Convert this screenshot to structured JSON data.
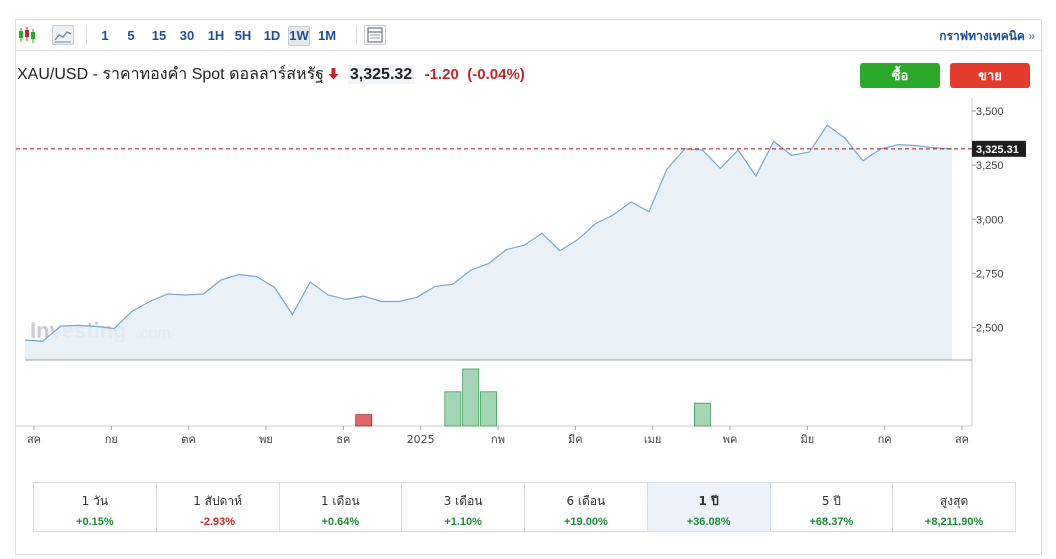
{
  "toolbar": {
    "intervals": [
      "1",
      "5",
      "15",
      "30",
      "1H",
      "5H",
      "1D",
      "1W",
      "1M"
    ],
    "active_interval": "1W",
    "tech_link": "กราฟทางเทคนิค",
    "tech_link_arrow": "»"
  },
  "header": {
    "pair": "XAU/USD - ราคาทองคำ Spot ดอลลาร์สหรัฐ",
    "direction": "down",
    "price": "3,325.32",
    "change": "-1.20",
    "change_pct": "(-0.04%)"
  },
  "actions": {
    "buy_label": "ซื้อ",
    "sell_label": "ขาย"
  },
  "watermark": {
    "brand": "Investing",
    "suffix": ".com"
  },
  "colors": {
    "line": "#7aa7cf",
    "area": "#e5eef6",
    "up_bar": "#a3d6b2",
    "down_bar": "#e06565",
    "ref_line": "#9b1c1c",
    "buy": "#2aa82a",
    "sell": "#e53b2c"
  },
  "chart_data": {
    "type": "area",
    "ylim": [
      2350,
      3560
    ],
    "y_ticks": [
      2500,
      2750,
      3000,
      3250,
      3500
    ],
    "y_tick_labels": [
      "2,500",
      "2,750",
      "3,000",
      "3,250",
      "3,500"
    ],
    "current_label": "3,325.31",
    "current_value": 3325.31,
    "grid": false,
    "x_labels": [
      "สค",
      "กย",
      "ตค",
      "พย",
      "ธค",
      "2025",
      "กพ",
      "มีค",
      "เมย",
      "พค",
      "มิย",
      "กค",
      "สค"
    ],
    "values": [
      2442,
      2437,
      2507,
      2510,
      2505,
      2495,
      2575,
      2620,
      2655,
      2650,
      2655,
      2720,
      2745,
      2735,
      2685,
      2560,
      2710,
      2650,
      2630,
      2645,
      2620,
      2620,
      2640,
      2690,
      2700,
      2765,
      2795,
      2860,
      2880,
      2935,
      2855,
      2905,
      2980,
      3020,
      3080,
      3035,
      3230,
      3325,
      3320,
      3235,
      3320,
      3200,
      3360,
      3295,
      3310,
      3435,
      3375,
      3270,
      3325,
      3345,
      3340,
      3330,
      3325
    ],
    "volume": [
      0,
      0,
      0,
      0,
      0,
      0,
      0,
      0,
      0,
      0,
      0,
      0,
      0,
      0,
      0,
      0,
      0,
      0,
      0,
      4,
      0,
      0,
      0,
      0,
      12,
      20,
      12,
      0,
      0,
      0,
      0,
      0,
      0,
      0,
      0,
      0,
      0,
      0,
      8,
      0,
      0,
      0,
      0,
      0,
      0,
      0,
      0,
      0,
      0,
      0,
      0,
      0,
      0
    ],
    "volume_direction": [
      "u",
      "u",
      "u",
      "u",
      "u",
      "u",
      "u",
      "u",
      "u",
      "u",
      "u",
      "u",
      "u",
      "u",
      "u",
      "u",
      "u",
      "u",
      "u",
      "d",
      "u",
      "u",
      "u",
      "u",
      "u",
      "u",
      "u",
      "u",
      "u",
      "u",
      "u",
      "u",
      "u",
      "u",
      "u",
      "u",
      "u",
      "u",
      "u",
      "u",
      "u",
      "u",
      "u",
      "u",
      "u",
      "u",
      "u",
      "u",
      "u",
      "u",
      "u",
      "u",
      "u"
    ]
  },
  "periods": [
    {
      "label": "1 วัน",
      "value": "+0.15%",
      "dir": "pos"
    },
    {
      "label": "1 สัปดาห์",
      "value": "-2.93%",
      "dir": "neg"
    },
    {
      "label": "1 เดือน",
      "value": "+0.64%",
      "dir": "pos"
    },
    {
      "label": "3 เดือน",
      "value": "+1.10%",
      "dir": "pos"
    },
    {
      "label": "6 เดือน",
      "value": "+19.00%",
      "dir": "pos"
    },
    {
      "label": "1 ปี",
      "value": "+36.08%",
      "dir": "pos",
      "active": true
    },
    {
      "label": "5 ปี",
      "value": "+68.37%",
      "dir": "pos"
    },
    {
      "label": "สูงสุด",
      "value": "+8,211.90%",
      "dir": "pos"
    }
  ]
}
